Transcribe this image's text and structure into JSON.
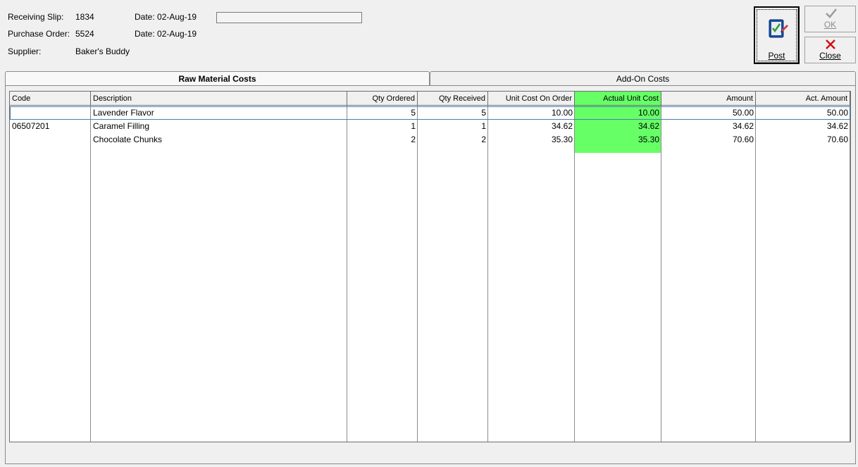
{
  "header": {
    "receiving_slip_label": "Receiving Slip:",
    "receiving_slip_value": "1834",
    "receiving_date": "Date: 02-Aug-19",
    "purchase_order_label": "Purchase Order:",
    "purchase_order_value": "5524",
    "purchase_order_date": "Date: 02-Aug-19",
    "supplier_label": "Supplier:",
    "supplier_value": "Baker's Buddy"
  },
  "buttons": {
    "post": "Post",
    "ok": "OK",
    "close": "Close"
  },
  "tabs": {
    "raw": "Raw Material Costs",
    "addon": "Add-On Costs"
  },
  "table": {
    "columns": [
      "Code",
      "Description",
      "Qty Ordered",
      "Qty Received",
      "Unit Cost On Order",
      "Actual Unit Cost",
      "Amount",
      "Act. Amount"
    ],
    "rows": [
      [
        "",
        "Lavender Flavor",
        "5",
        "5",
        "10.00",
        "10.00",
        "50.00",
        "50.00"
      ],
      [
        "06507201",
        "Caramel Filling",
        "1",
        "1",
        "34.62",
        "34.62",
        "34.62",
        "34.62"
      ],
      [
        "",
        "Chocolate Chunks",
        "2",
        "2",
        "35.30",
        "35.30",
        "70.60",
        "70.60"
      ]
    ]
  },
  "colors": {
    "highlight_column": "#66ff66",
    "selection_border": "#4a7fb5"
  }
}
